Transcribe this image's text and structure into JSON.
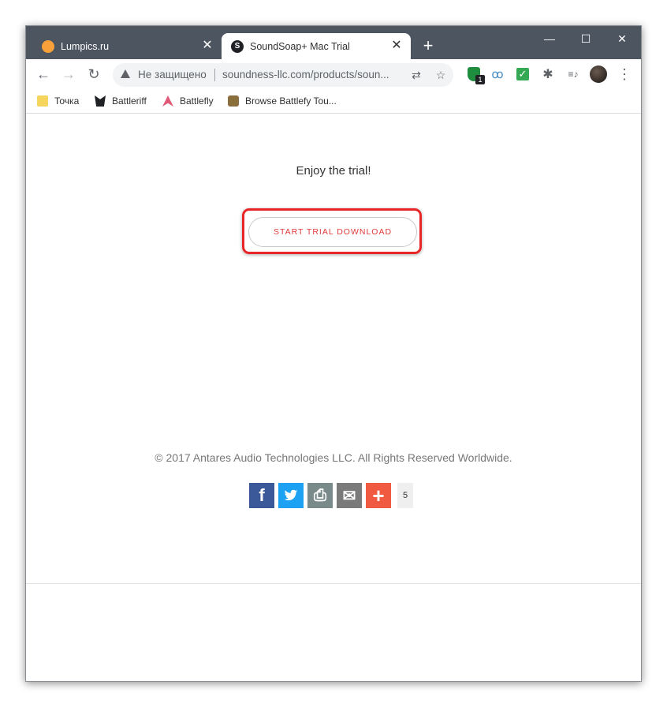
{
  "tabs": [
    {
      "title": "Lumpics.ru",
      "active": false,
      "favicon": "orange-circle-icon"
    },
    {
      "title": "SoundSoap+ Mac Trial",
      "active": true,
      "favicon": "s-logo-icon"
    }
  ],
  "tab_close_glyph": "✕",
  "new_tab_glyph": "+",
  "window_controls": {
    "minimize": "—",
    "maximize": "☐",
    "close": "✕"
  },
  "nav": {
    "back": "←",
    "forward": "→",
    "reload": "↻",
    "menu": "⋮"
  },
  "omnibox": {
    "security_text": "Не защищено",
    "url": "soundness-llc.com/products/soun...",
    "translate_glyph": "⇄",
    "bookmark_glyph": "☆"
  },
  "extensions": {
    "shield_badge": "1",
    "check_glyph": "✓",
    "puzzle_glyph": "✱",
    "media_glyph": "≡♪",
    "glasses_glyph": "ꝏ"
  },
  "bookmarks": [
    {
      "label": "Точка",
      "icon": "folder-icon"
    },
    {
      "label": "Battleriff",
      "icon": "wolf-icon"
    },
    {
      "label": "Battlefly",
      "icon": "battlefly-icon"
    },
    {
      "label": "Browse Battlefy Tou...",
      "icon": "battlefy-icon"
    }
  ],
  "page": {
    "heading": "Enjoy the trial!",
    "download_button": "START TRIAL DOWNLOAD",
    "copyright": "© 2017 Antares Audio Technologies LLC. All Rights Reserved Worldwide.",
    "share_buttons": [
      {
        "name": "facebook",
        "glyph": "f",
        "color": "#3b5998"
      },
      {
        "name": "twitter",
        "glyph": "🐦",
        "color": "#1da1f2"
      },
      {
        "name": "print",
        "glyph": "⎙",
        "color": "#7a8a8a"
      },
      {
        "name": "email",
        "glyph": "✉",
        "color": "#7a7a7a"
      },
      {
        "name": "more",
        "glyph": "+",
        "color": "#f05a40"
      }
    ],
    "share_count": "5"
  },
  "colors": {
    "titlebar": "#4d5561",
    "highlight_border": "#e8262a",
    "button_text": "#e03a3a"
  }
}
